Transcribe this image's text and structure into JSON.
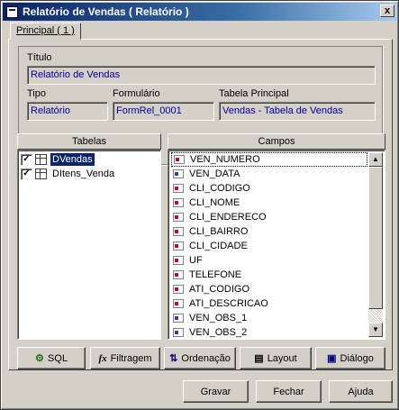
{
  "window": {
    "title": "Relatório de Vendas ( Relatório )",
    "close_glyph": "x"
  },
  "tab": {
    "label": "Principal ( 1 )"
  },
  "form": {
    "titulo_label": "Título",
    "titulo_value": "Relatório de Vendas",
    "tipo_label": "Tipo",
    "tipo_value": "Relatório",
    "formulario_label": "Formulário",
    "formulario_value": "FormRel_0001",
    "tabela_label": "Tabela Principal",
    "tabela_value": "Vendas - Tabela de Vendas"
  },
  "tables_panel": {
    "header": "Tabelas",
    "items": [
      {
        "label": "DVendas",
        "checked": true,
        "selected": true
      },
      {
        "label": "DItens_Venda",
        "checked": true,
        "selected": false
      }
    ]
  },
  "fields_panel": {
    "header": "Campos",
    "items": [
      {
        "label": "VEN_NUMERO",
        "icon": "key-field-icon"
      },
      {
        "label": "VEN_DATA",
        "icon": "field-icon"
      },
      {
        "label": "CLI_CODIGO",
        "icon": "key-field-icon"
      },
      {
        "label": "CLI_NOME",
        "icon": "key-field-icon"
      },
      {
        "label": "CLI_ENDERECO",
        "icon": "key-field-icon"
      },
      {
        "label": "CLI_BAIRRO",
        "icon": "key-field-icon"
      },
      {
        "label": "CLI_CIDADE",
        "icon": "key-field-icon"
      },
      {
        "label": "UF",
        "icon": "key-field-icon"
      },
      {
        "label": "TELEFONE",
        "icon": "key-field-icon"
      },
      {
        "label": "ATI_CODIGO",
        "icon": "key-field-icon"
      },
      {
        "label": "ATI_DESCRICAO",
        "icon": "key-field-icon"
      },
      {
        "label": "VEN_OBS_1",
        "icon": "field-icon"
      },
      {
        "label": "VEN_OBS_2",
        "icon": "field-icon"
      }
    ]
  },
  "toolbar": {
    "sql": "SQL",
    "filtragem": "Filtragem",
    "ordenacao": "Ordenação",
    "layout": "Layout",
    "dialogo": "Diálogo"
  },
  "footer": {
    "gravar": "Gravar",
    "fechar": "Fechar",
    "ajuda": "Ajuda"
  }
}
